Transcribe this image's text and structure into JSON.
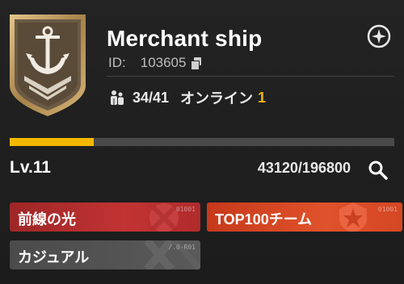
{
  "guild": {
    "name": "Merchant ship",
    "id_label": "ID:",
    "id_value": "103605",
    "members": "34/41",
    "online_label": "オンライン",
    "online_count": "1",
    "emblem_icon": "anchor-shield-emblem"
  },
  "level": {
    "label": "Lv.11",
    "xp_current": 43120,
    "xp_max": 196800,
    "xp_text": "43120/196800",
    "progress_fraction": 0.219
  },
  "tags": [
    {
      "label": "前線の光",
      "code": "01001",
      "color": "#b82e2e",
      "icon": "crossed-swords-icon"
    },
    {
      "label": "TOP100チーム",
      "code": "01001",
      "color": "#d84a26",
      "icon": "star-badge-icon"
    },
    {
      "label": "カジュアル",
      "code": "/.0-R01",
      "color": "#555555",
      "icon": "cross-pattern-icon"
    }
  ],
  "colors": {
    "accent": "#f5b800",
    "online": "#f2b705"
  }
}
